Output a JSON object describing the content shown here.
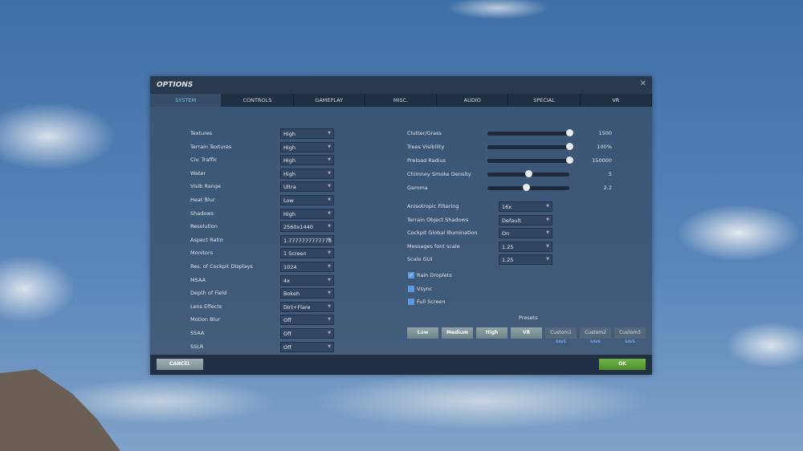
{
  "title": "OPTIONS",
  "tabs": [
    "SYSTEM",
    "CONTROLS",
    "GAMEPLAY",
    "MISC.",
    "AUDIO",
    "SPECIAL",
    "VR"
  ],
  "active_tab": "SYSTEM",
  "left_settings": [
    {
      "label": "Textures",
      "value": "High"
    },
    {
      "label": "Terrain Textures",
      "value": "High"
    },
    {
      "label": "Civ. Traffic",
      "value": "High"
    },
    {
      "label": "Water",
      "value": "High"
    },
    {
      "label": "Visib Range",
      "value": "Ultra"
    },
    {
      "label": "Heat Blur",
      "value": "Low"
    },
    {
      "label": "Shadows",
      "value": "High"
    },
    {
      "label": "Resolution",
      "value": "2560x1440"
    },
    {
      "label": "Aspect Ratio",
      "value": "1.7777777777778"
    },
    {
      "label": "Monitors",
      "value": "1 Screen"
    },
    {
      "label": "Res. of Cockpit Displays",
      "value": "1024"
    },
    {
      "label": "MSAA",
      "value": "4x"
    },
    {
      "label": "Depth of Field",
      "value": "Bokeh"
    },
    {
      "label": "Lens Effects",
      "value": "Dirt+Flare"
    },
    {
      "label": "Motion Blur",
      "value": "Off"
    },
    {
      "label": "SSAA",
      "value": "Off"
    },
    {
      "label": "SSLR",
      "value": "Off"
    }
  ],
  "sliders": [
    {
      "label": "Clutter/Grass",
      "value": "1500",
      "level": 1.0
    },
    {
      "label": "Trees Visibility",
      "value": "100%",
      "level": 1.0
    },
    {
      "label": "Preload Radius",
      "value": "150000",
      "level": 1.0
    },
    {
      "label": "Chimney Smoke Density",
      "value": "5",
      "level": 0.5
    },
    {
      "label": "Gamma",
      "value": "2.2",
      "level": 0.48
    }
  ],
  "right_settings": [
    {
      "label": "Anisotropic Filtering",
      "value": "16x"
    },
    {
      "label": "Terrain Object Shadows",
      "value": "Default"
    },
    {
      "label": "Cockpit Global Illumination",
      "value": "On"
    },
    {
      "label": "Messages font scale",
      "value": "1.25"
    },
    {
      "label": "Scale GUI",
      "value": "1.25"
    }
  ],
  "checkboxes": [
    {
      "label": "Rain Droplets",
      "checked": true
    },
    {
      "label": "Vsync",
      "checked": false
    },
    {
      "label": "Full Screen",
      "checked": false
    }
  ],
  "presets": {
    "label": "Presets",
    "buttons": [
      "Low",
      "Medium",
      "High",
      "VR",
      "Custom1",
      "Custom2",
      "Custom3"
    ],
    "save_label": "SAVE"
  },
  "footer": {
    "cancel": "CANCEL",
    "ok": "OK"
  },
  "colors": {
    "accent_tab": "#6ec8ea",
    "ok_green": "#5fa33a",
    "checkbox": "#5b9ae0"
  }
}
